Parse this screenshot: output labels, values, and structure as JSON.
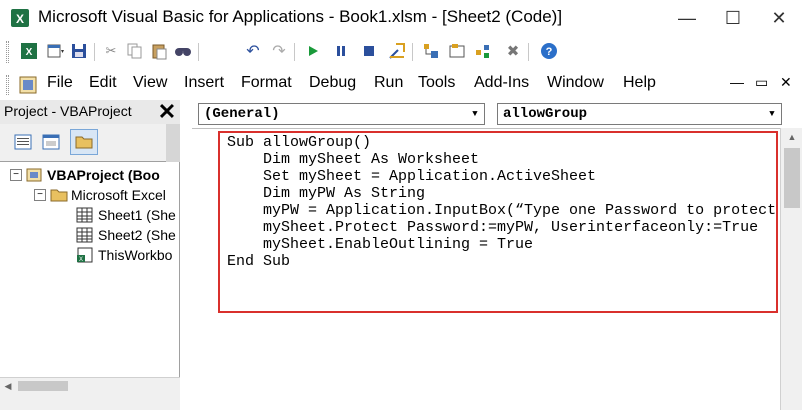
{
  "window": {
    "title": "Microsoft Visual Basic for Applications - Book1.xlsm - [Sheet2 (Code)]",
    "minimize": "—",
    "maximize": "☐",
    "close": "✕"
  },
  "toolbar": {
    "icons": [
      "excel-icon",
      "insert-icon",
      "save-icon",
      "cut-icon",
      "copy-icon",
      "paste-icon",
      "find-icon",
      "undo-icon",
      "redo-icon",
      "run-icon",
      "break-icon",
      "reset-icon",
      "design-mode-icon",
      "project-explorer-icon",
      "properties-icon",
      "object-browser-icon",
      "toolbox-icon",
      "help-icon"
    ]
  },
  "menu": {
    "items": [
      "File",
      "Edit",
      "View",
      "Insert",
      "Format",
      "Debug",
      "Run",
      "Tools",
      "Add-Ins",
      "Window",
      "Help"
    ],
    "restore": "▭",
    "close": "✕"
  },
  "project": {
    "title": "Project - VBAProject",
    "close": "✕",
    "tree": {
      "root": "VBAProject (Boo",
      "folder": "Microsoft Excel",
      "items": [
        "Sheet1 (She",
        "Sheet2 (She",
        "ThisWorkbo"
      ]
    }
  },
  "code": {
    "object_dropdown": "(General)",
    "procedure_dropdown": "allowGroup",
    "lines": [
      "Sub allowGroup()",
      "    Dim mySheet As Worksheet",
      "    Set mySheet = Application.ActiveSheet",
      "    Dim myPW As String",
      "    myPW = Application.InputBox(“Type one Password to protect",
      "    mySheet.Protect Password:=myPW, Userinterfaceonly:=True",
      "    mySheet.EnableOutlining = True",
      "End Sub"
    ]
  },
  "colors": {
    "highlight": "#d9302c",
    "pane_header": "#e9e9e9"
  }
}
